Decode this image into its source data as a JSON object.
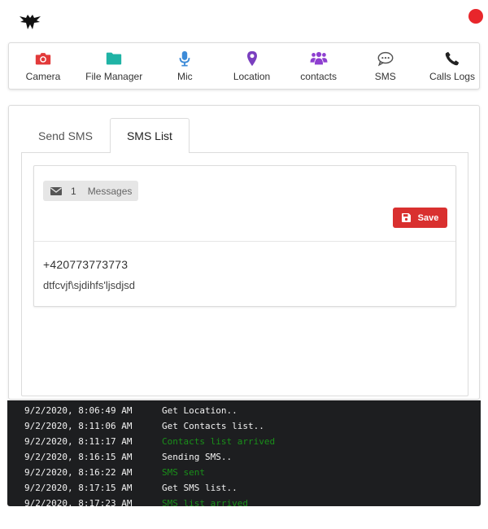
{
  "header": {
    "logo_icon": "eagle-logo-icon",
    "status_color": "#e8262b"
  },
  "toolbar": {
    "items": [
      {
        "label": "Camera",
        "icon": "camera-icon",
        "color": "#e23a3a"
      },
      {
        "label": "File Manager",
        "icon": "folder-icon",
        "color": "#1fb3a5"
      },
      {
        "label": "Mic",
        "icon": "microphone-icon",
        "color": "#3d8bd8"
      },
      {
        "label": "Location",
        "icon": "location-pin-icon",
        "color": "#7a3fbf"
      },
      {
        "label": "contacts",
        "icon": "users-icon",
        "color": "#8e3fd0"
      },
      {
        "label": "SMS",
        "icon": "chat-bubble-icon",
        "color": "#555555"
      },
      {
        "label": "Calls Logs",
        "icon": "phone-icon",
        "color": "#222222"
      }
    ]
  },
  "tabs": [
    {
      "label": "Send SMS",
      "active": false
    },
    {
      "label": "SMS List",
      "active": true
    }
  ],
  "sms_list": {
    "count": "1",
    "count_label": "Messages",
    "save_label": "Save",
    "save_color": "#d9302f",
    "messages": [
      {
        "number": "+420773773773",
        "body": "dtfcvjf\\sjdihfs'ljsdjsd"
      }
    ]
  },
  "console": {
    "lines": [
      {
        "time": "9/2/2020, 8:06:49 AM",
        "message": "Get Location..",
        "type": "info"
      },
      {
        "time": "9/2/2020, 8:11:06 AM",
        "message": "Get Contacts list..",
        "type": "info"
      },
      {
        "time": "9/2/2020, 8:11:17 AM",
        "message": "Contacts list arrived",
        "type": "success"
      },
      {
        "time": "9/2/2020, 8:16:15 AM",
        "message": "Sending SMS..",
        "type": "info"
      },
      {
        "time": "9/2/2020, 8:16:22 AM",
        "message": "SMS sent",
        "type": "success"
      },
      {
        "time": "9/2/2020, 8:17:15 AM",
        "message": "Get SMS list..",
        "type": "info"
      },
      {
        "time": "9/2/2020, 8:17:23 AM",
        "message": "SMS list arrived",
        "type": "success"
      }
    ]
  }
}
